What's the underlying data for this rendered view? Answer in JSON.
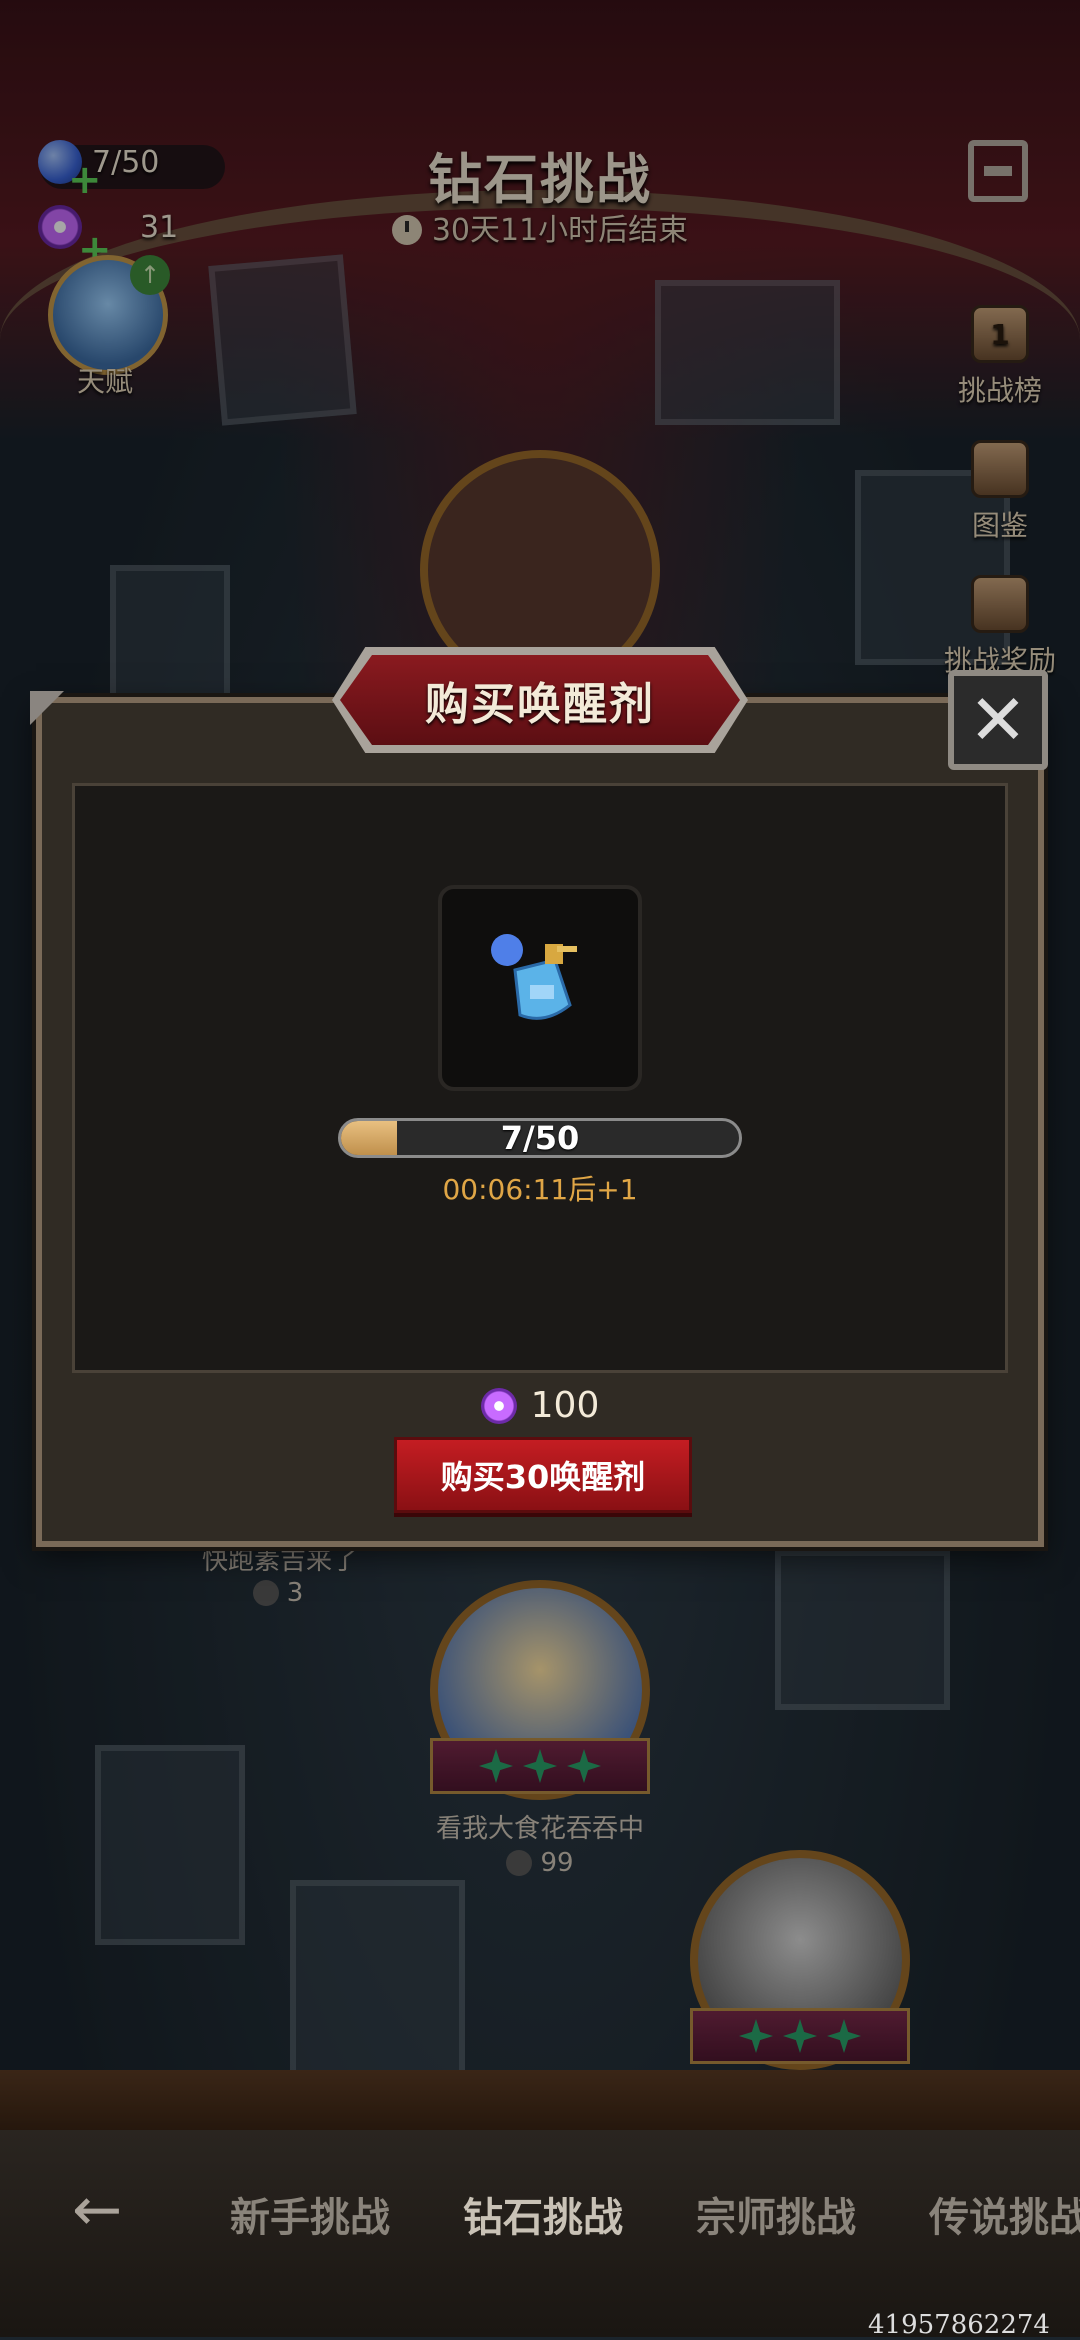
{
  "header": {
    "title": "钻石挑战",
    "subtitle": "30天11小时后结束",
    "energy": "7/50",
    "candy": "31",
    "avatar_label": "天赋"
  },
  "side_menu": [
    {
      "label": "挑战榜",
      "badge": "1",
      "icon": "trophy-icon"
    },
    {
      "label": "图鉴",
      "icon": "book-stack-icon"
    },
    {
      "label": "挑战奖励",
      "icon": "gift-box-icon"
    }
  ],
  "modal": {
    "title": "购买唤醒剂",
    "item_icon": "awakening-potion-icon",
    "progress_text": "7/50",
    "progress_fraction": 0.14,
    "timer": "00:06:11后+1",
    "cost": "100",
    "buy_label": "购买30唤醒剂"
  },
  "stages": [
    {
      "name": "快跑素吉来了",
      "deaths": "3"
    },
    {
      "name": "看我大食花吞吞中",
      "deaths": "99"
    }
  ],
  "tabs": [
    "新手挑战",
    "钻石挑战",
    "宗师挑战",
    "传说挑战"
  ],
  "active_tab": 1,
  "watermark": "41957862274",
  "colors": {
    "accent_red": "#c41d22",
    "timer_orange": "#e0a646",
    "progress_fill": "#e8c081"
  }
}
